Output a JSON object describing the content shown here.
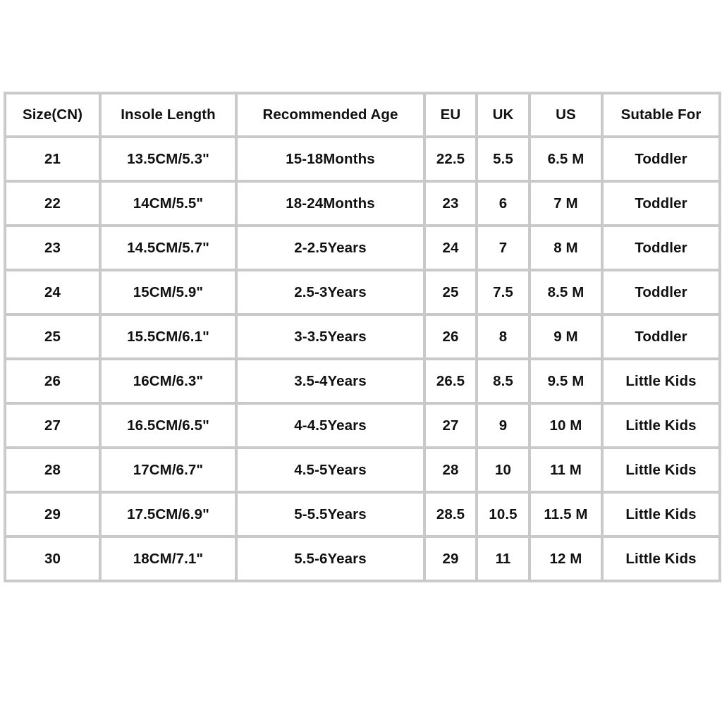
{
  "table": {
    "columns": [
      {
        "key": "size_cn",
        "label": "Size(CN)"
      },
      {
        "key": "insole_length",
        "label": "Insole Length"
      },
      {
        "key": "recommended_age",
        "label": "Recommended Age"
      },
      {
        "key": "eu",
        "label": "EU"
      },
      {
        "key": "uk",
        "label": "UK"
      },
      {
        "key": "us",
        "label": "US"
      },
      {
        "key": "suitable_for",
        "label": "Sutable For"
      }
    ],
    "rows": [
      {
        "size_cn": "21",
        "insole_length": "13.5CM/5.3\"",
        "recommended_age": "15-18Months",
        "eu": "22.5",
        "uk": "5.5",
        "us": "6.5 M",
        "suitable_for": "Toddler"
      },
      {
        "size_cn": "22",
        "insole_length": "14CM/5.5\"",
        "recommended_age": "18-24Months",
        "eu": "23",
        "uk": "6",
        "us": "7 M",
        "suitable_for": "Toddler"
      },
      {
        "size_cn": "23",
        "insole_length": "14.5CM/5.7\"",
        "recommended_age": "2-2.5Years",
        "eu": "24",
        "uk": "7",
        "us": "8 M",
        "suitable_for": "Toddler"
      },
      {
        "size_cn": "24",
        "insole_length": "15CM/5.9\"",
        "recommended_age": "2.5-3Years",
        "eu": "25",
        "uk": "7.5",
        "us": "8.5 M",
        "suitable_for": "Toddler"
      },
      {
        "size_cn": "25",
        "insole_length": "15.5CM/6.1\"",
        "recommended_age": "3-3.5Years",
        "eu": "26",
        "uk": "8",
        "us": "9 M",
        "suitable_for": "Toddler"
      },
      {
        "size_cn": "26",
        "insole_length": "16CM/6.3\"",
        "recommended_age": "3.5-4Years",
        "eu": "26.5",
        "uk": "8.5",
        "us": "9.5 M",
        "suitable_for": "Little Kids"
      },
      {
        "size_cn": "27",
        "insole_length": "16.5CM/6.5\"",
        "recommended_age": "4-4.5Years",
        "eu": "27",
        "uk": "9",
        "us": "10 M",
        "suitable_for": "Little Kids"
      },
      {
        "size_cn": "28",
        "insole_length": "17CM/6.7\"",
        "recommended_age": "4.5-5Years",
        "eu": "28",
        "uk": "10",
        "us": "11 M",
        "suitable_for": "Little Kids"
      },
      {
        "size_cn": "29",
        "insole_length": "17.5CM/6.9\"",
        "recommended_age": "5-5.5Years",
        "eu": "28.5",
        "uk": "10.5",
        "us": "11.5 M",
        "suitable_for": "Little Kids"
      },
      {
        "size_cn": "30",
        "insole_length": "18CM/7.1\"",
        "recommended_age": "5.5-6Years",
        "eu": "29",
        "uk": "11",
        "us": "12 M",
        "suitable_for": "Little Kids"
      }
    ]
  },
  "colors": {
    "background": "#ffffff",
    "cell_background": "#ffffff",
    "border": "#c9c9c9",
    "text": "#111111"
  }
}
